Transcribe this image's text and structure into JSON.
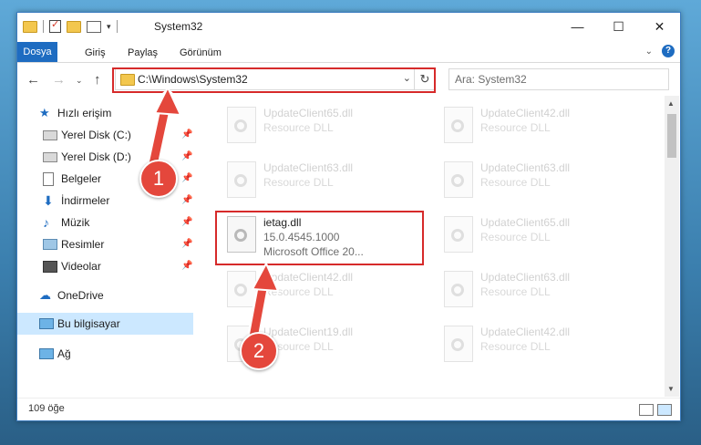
{
  "window": {
    "title": "System32"
  },
  "ribbon": {
    "tabs": [
      "Dosya",
      "Giriş",
      "Paylaş",
      "Görünüm"
    ],
    "help": "?"
  },
  "address": {
    "path": "C:\\Windows\\System32"
  },
  "search": {
    "placeholder": "Ara: System32"
  },
  "sidebar": {
    "quick_access": "Hızlı erişim",
    "items": [
      "Yerel Disk (C:)",
      "Yerel Disk (D:)",
      "Belgeler",
      "İndirmeler",
      "Müzik",
      "Resimler",
      "Videolar"
    ],
    "onedrive": "OneDrive",
    "this_pc": "Bu bilgisayar",
    "network": "Ağ"
  },
  "files": [
    {
      "name": "UpdateClient65.dll",
      "type": "Resource DLL"
    },
    {
      "name": "UpdateClient42.dll",
      "type": "Resource DLL"
    },
    {
      "name": "UpdateClient63.dll",
      "type": "Resource DLL"
    },
    {
      "name": "UpdateClient63.dll",
      "type": "Resource DLL"
    },
    {
      "name": "ietag.dll",
      "version": "15.0.4545.1000",
      "company": "Microsoft Office 20..."
    },
    {
      "name": "UpdateClient65.dll",
      "type": "Resource DLL"
    },
    {
      "name": "UpdateClient42.dll",
      "type": "Resource DLL"
    },
    {
      "name": "UpdateClient63.dll",
      "type": "Resource DLL"
    },
    {
      "name": "UpdateClient19.dll",
      "type": "Resource DLL"
    },
    {
      "name": "UpdateClient42.dll",
      "type": "Resource DLL"
    }
  ],
  "status": {
    "count": "109 öğe"
  },
  "annotations": {
    "badge1": "1",
    "badge2": "2",
    "color": "#e4473c"
  }
}
